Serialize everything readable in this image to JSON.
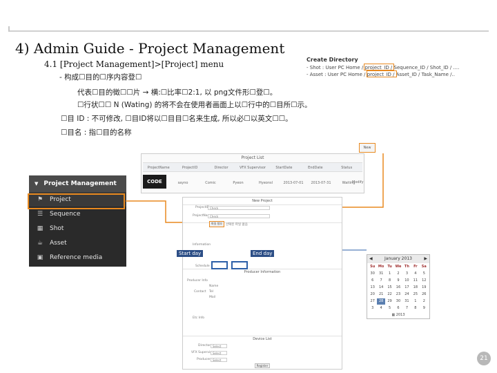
{
  "header": {
    "title": "4) Admin Guide - Project Management",
    "subtitle": "4.1 [Project Management]>[Project] menu"
  },
  "body": {
    "line1": "- 构成☐目的☐序内容登☐",
    "line2": "代表☐目的徵☐☐片 → 横:☐比率☐2:1, 以 png文件形☐登☐。",
    "line3": "☐行状☐☐ N (Wating) 的将不会在使用者画面上以☐行中的☐目所☐示。",
    "line4": "☐目 ID : 不可修改, ☐目ID将以☐目目☐名来生成, 所以必☐以英文☐☐。",
    "line5": "☐目名 : 指☐目的名称"
  },
  "create_directory": {
    "title": "Create Directory",
    "shot": "- Shot : User PC Home / project_ID / Sequence_ID / Shot_ID / ....",
    "asset": "- Asset : User PC Home / project_ID / Asset_ID / Task_Name /.."
  },
  "project_list": {
    "title": "Project List",
    "columns": [
      "ProjectName",
      "ProjectID",
      "Director",
      "VFX Supervisor",
      "StartDate",
      "EndDate",
      "Status"
    ],
    "row": [
      "sayno",
      "Comic",
      "Pyeon",
      "Hyeonsl",
      "2013-07-01",
      "2013-07-31",
      "Waiting"
    ],
    "new_button": "New",
    "modify_label": "Modify",
    "logo_text": "CODE"
  },
  "sidebar": {
    "header": "Project Management",
    "items": [
      {
        "label": "Project",
        "icon": "flag-icon"
      },
      {
        "label": "Sequence",
        "icon": "list-icon"
      },
      {
        "label": "Shot",
        "icon": "film-icon"
      },
      {
        "label": "Asset",
        "icon": "teapot-icon"
      },
      {
        "label": "Reference media",
        "icon": "media-icon"
      }
    ]
  },
  "form": {
    "title": "New Project",
    "project_id_label": "ProjectID",
    "project_name_label": "ProjectName",
    "check_value": "Check",
    "upload_button": "파일 첨부",
    "upload_hint": "선택된 파일 없음",
    "information_label": "Information",
    "schedule_label": "Schedule",
    "producer_info_title": "Producer Information",
    "producer_info_label": "Producer Info",
    "contact_label": "Contact",
    "name_label": "Name",
    "tel_label": "Tel",
    "mail_label": "Mail",
    "etc_label": "Etc Info",
    "device_list_title": "Device List",
    "device_labels": [
      "Director",
      "VFX Supervisor",
      "Producer"
    ],
    "select_value": "Select",
    "register_button": "Register"
  },
  "annotations": {
    "start_day": "Start day",
    "end_day": "End day"
  },
  "calendar": {
    "month": "January 2013",
    "days_of_week": [
      "Su",
      "Mo",
      "Tu",
      "We",
      "Th",
      "Fr",
      "Sa"
    ],
    "weeks": [
      [
        "30",
        "31",
        "1",
        "2",
        "3",
        "4",
        "5"
      ],
      [
        "6",
        "7",
        "8",
        "9",
        "10",
        "11",
        "12"
      ],
      [
        "13",
        "14",
        "15",
        "16",
        "17",
        "18",
        "19"
      ],
      [
        "20",
        "21",
        "22",
        "23",
        "24",
        "25",
        "26"
      ],
      [
        "27",
        "28",
        "29",
        "30",
        "31",
        "1",
        "2"
      ],
      [
        "3",
        "4",
        "5",
        "6",
        "7",
        "8",
        "9"
      ]
    ],
    "selected": "28",
    "footer": "2013"
  },
  "page_number": "21",
  "colors": {
    "highlight_orange": "#e8891f",
    "highlight_blue": "#2c5fa8",
    "sidebar_bg": "#2a2a2a"
  }
}
